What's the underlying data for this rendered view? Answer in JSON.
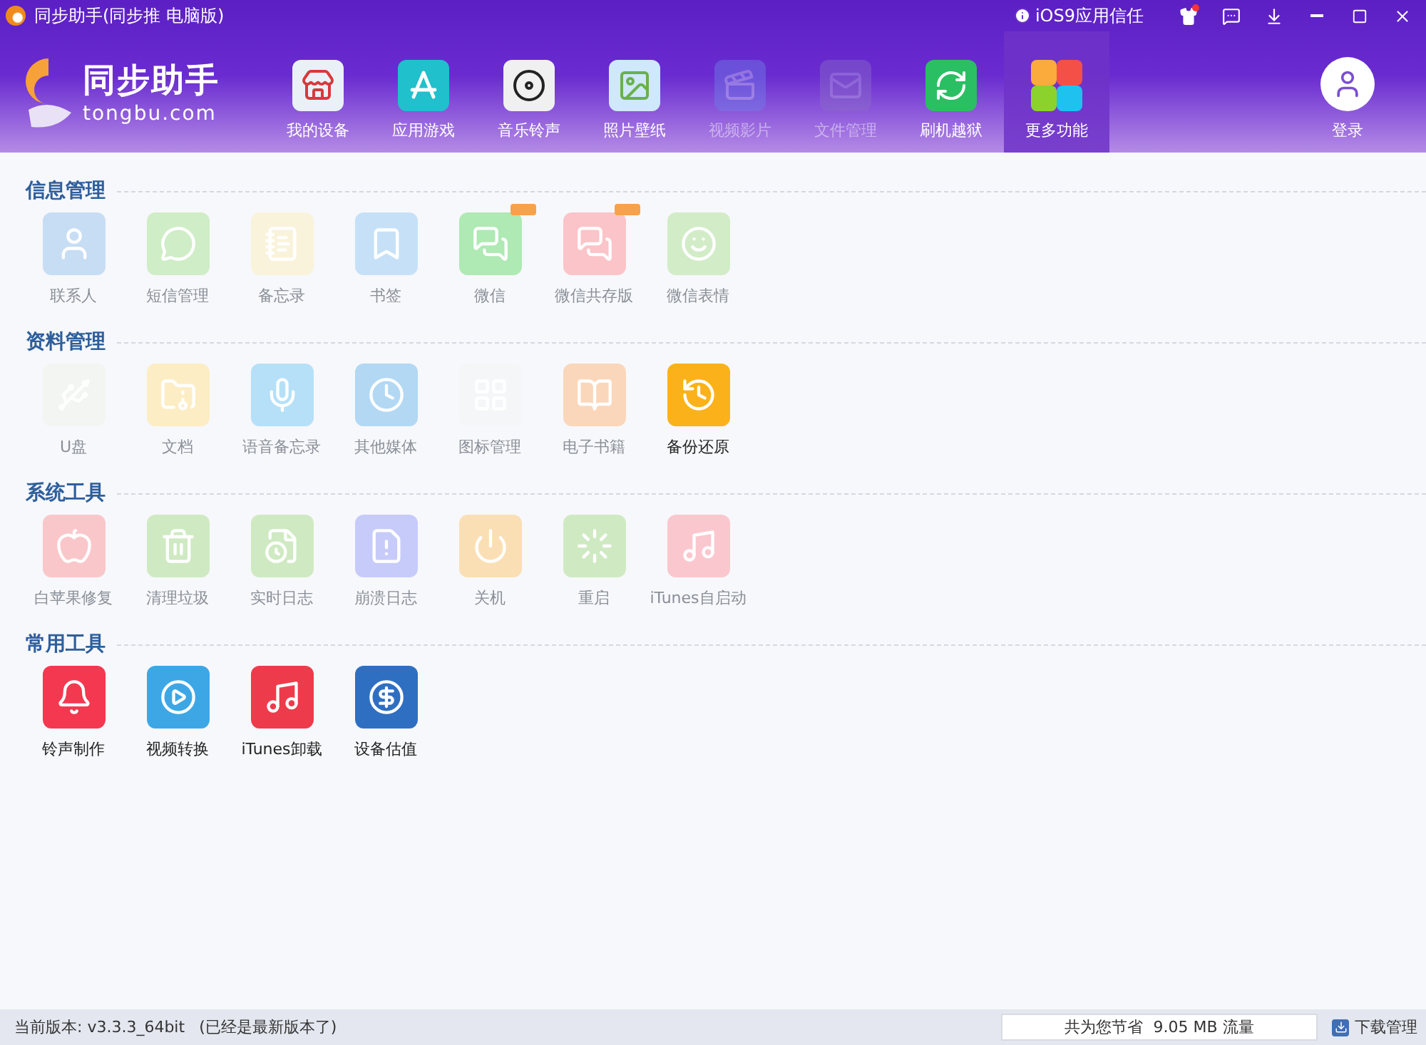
{
  "window": {
    "title": "同步助手(同步推 电脑版)",
    "trust_link": "iOS9应用信任"
  },
  "logo": {
    "name": "同步助手",
    "site": "tongbu.com"
  },
  "nav": [
    {
      "label": "我的设备",
      "selected": false,
      "disabled": false
    },
    {
      "label": "应用游戏",
      "selected": false,
      "disabled": false
    },
    {
      "label": "音乐铃声",
      "selected": false,
      "disabled": false
    },
    {
      "label": "照片壁纸",
      "selected": false,
      "disabled": false
    },
    {
      "label": "视频影片",
      "selected": false,
      "disabled": true
    },
    {
      "label": "文件管理",
      "selected": false,
      "disabled": true
    },
    {
      "label": "刷机越狱",
      "selected": false,
      "disabled": false
    },
    {
      "label": "更多功能",
      "selected": true,
      "disabled": false
    }
  ],
  "login": "登录",
  "sections": [
    {
      "title": "信息管理",
      "tools": [
        {
          "label": "联系人",
          "disabled": true,
          "color": "#c7ddf4"
        },
        {
          "label": "短信管理",
          "disabled": true,
          "color": "#cfedc6"
        },
        {
          "label": "备忘录",
          "disabled": true,
          "color": "#faf3db"
        },
        {
          "label": "书签",
          "disabled": true,
          "color": "#c6e1f7"
        },
        {
          "label": "微信",
          "disabled": true,
          "color": "#afe9b4",
          "new_badge": true
        },
        {
          "label": "微信共存版",
          "disabled": true,
          "color": "#fbc4c9",
          "new_badge": true
        },
        {
          "label": "微信表情",
          "disabled": true,
          "color": "#d2ecc8"
        }
      ]
    },
    {
      "title": "资料管理",
      "tools": [
        {
          "label": "U盘",
          "disabled": true,
          "color": "#f3f5f3"
        },
        {
          "label": "文档",
          "disabled": true,
          "color": "#fcedc5"
        },
        {
          "label": "语音备忘录",
          "disabled": true,
          "color": "#b5e0f8"
        },
        {
          "label": "其他媒体",
          "disabled": true,
          "color": "#b2d8f3"
        },
        {
          "label": "图标管理",
          "disabled": true,
          "color": "#f4f6f7"
        },
        {
          "label": "电子书籍",
          "disabled": true,
          "color": "#fad7bb"
        },
        {
          "label": "备份还原",
          "disabled": false,
          "color": "#fbb21a"
        }
      ]
    },
    {
      "title": "系统工具",
      "tools": [
        {
          "label": "白苹果修复",
          "disabled": true,
          "color": "#f9c7ca"
        },
        {
          "label": "清理垃圾",
          "disabled": true,
          "color": "#cfeac2"
        },
        {
          "label": "实时日志",
          "disabled": true,
          "color": "#cfeac2"
        },
        {
          "label": "崩溃日志",
          "disabled": true,
          "color": "#c7cbfa"
        },
        {
          "label": "关机",
          "disabled": true,
          "color": "#fbdfb4"
        },
        {
          "label": "重启",
          "disabled": true,
          "color": "#cfeac2"
        },
        {
          "label": "iTunes自启动",
          "disabled": true,
          "color": "#fbc7ce"
        }
      ]
    },
    {
      "title": "常用工具",
      "tools": [
        {
          "label": "铃声制作",
          "disabled": false,
          "color": "#f4384f"
        },
        {
          "label": "视频转换",
          "disabled": false,
          "color": "#3da7e6"
        },
        {
          "label": "iTunes卸载",
          "disabled": false,
          "color": "#ee3b4b"
        },
        {
          "label": "设备估值",
          "disabled": false,
          "color": "#2f6fc2"
        }
      ]
    }
  ],
  "status_bar": {
    "version": "当前版本: v3.3.3_64bit",
    "note": "(已经是最新版本了)",
    "saved": "共为您节省  9.05 MB 流量",
    "downloads": "下载管理"
  }
}
